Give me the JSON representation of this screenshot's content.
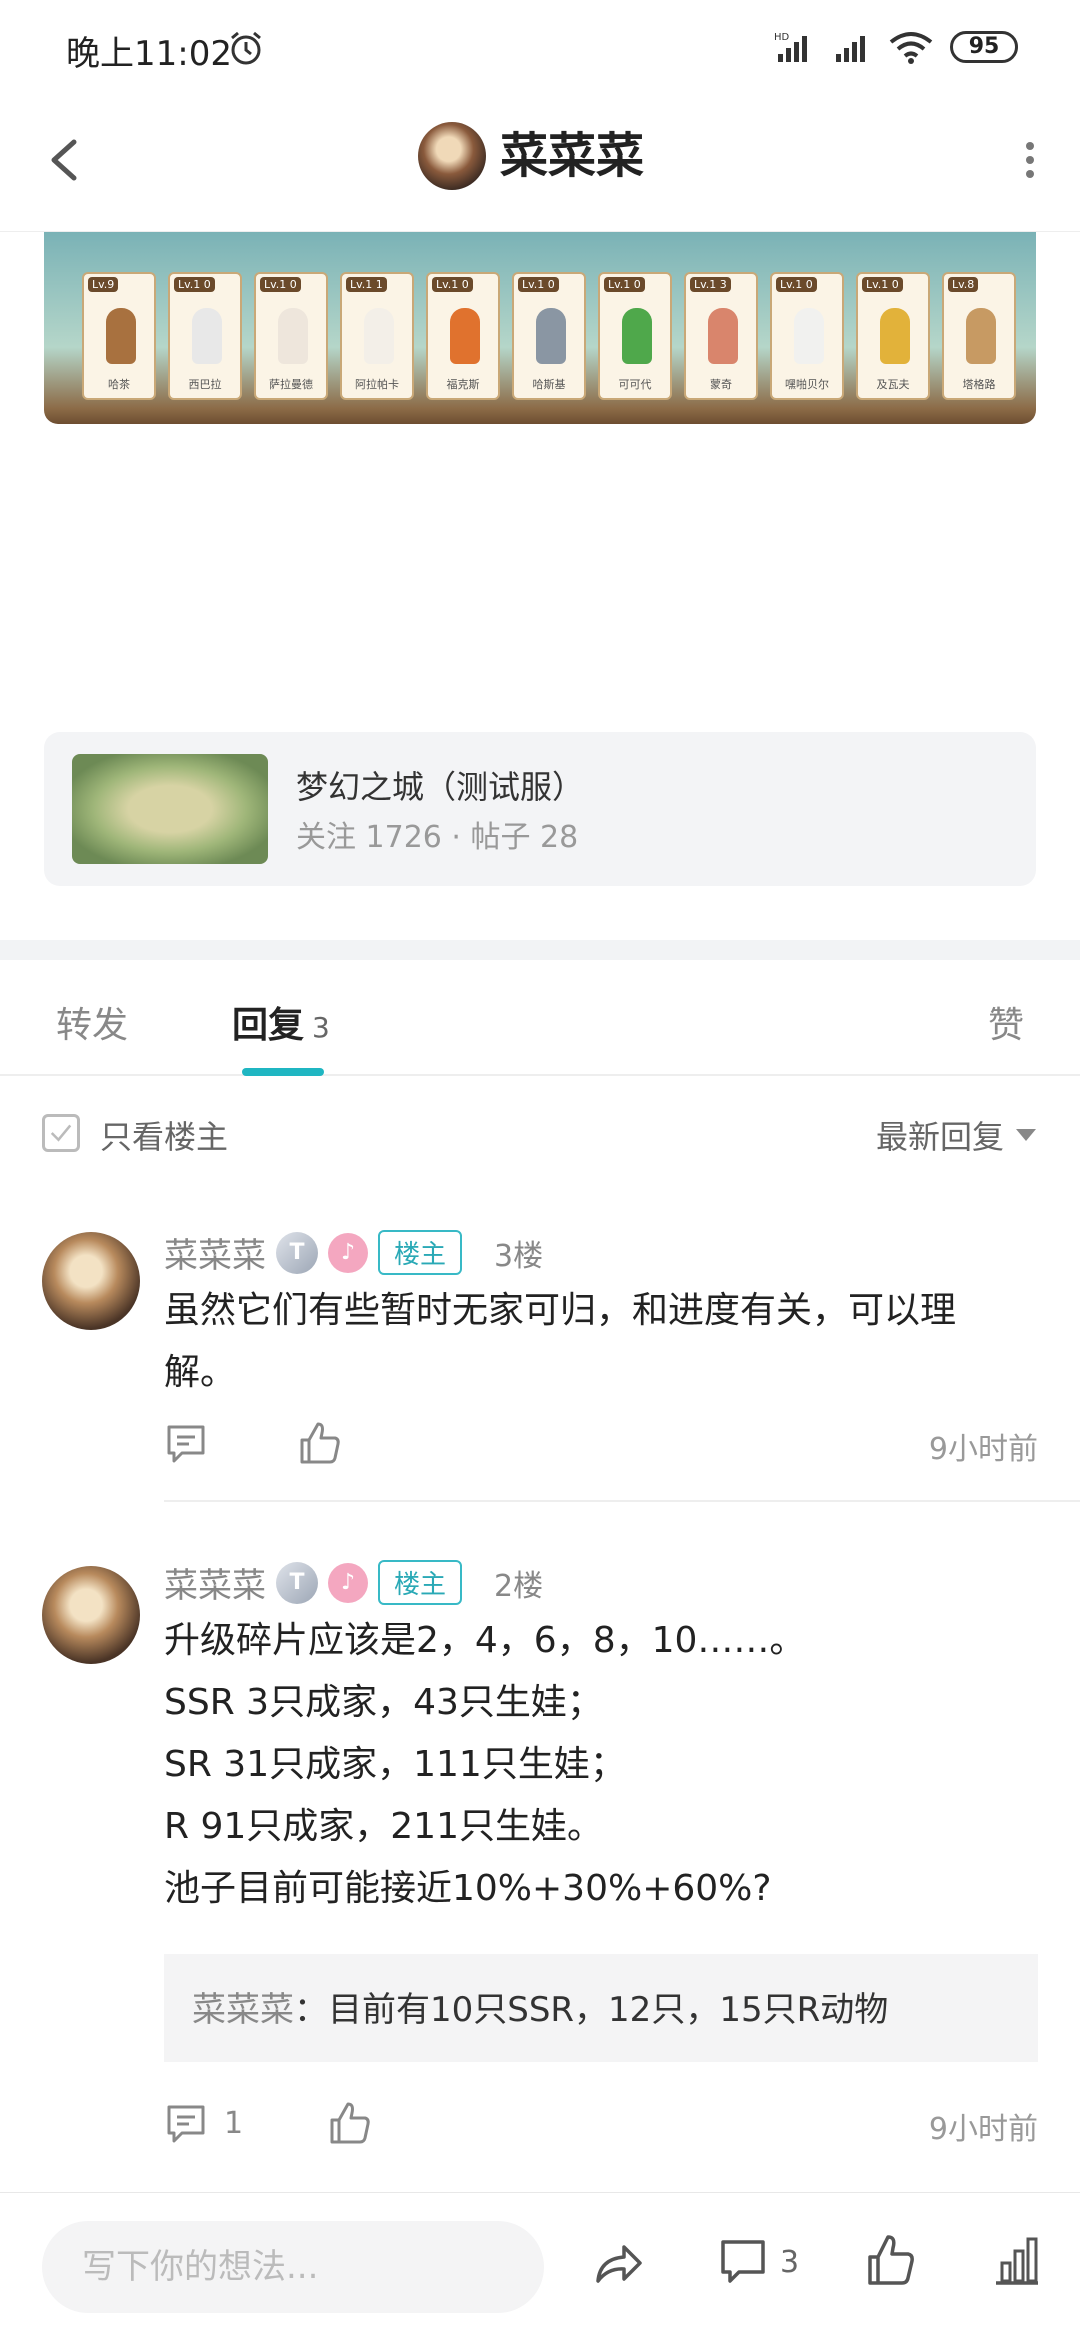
{
  "status_bar": {
    "time": "晚上11:02",
    "battery": "95"
  },
  "header": {
    "title": "菜菜菜"
  },
  "game_cards": [
    {
      "lv": "Lv.9",
      "name": "哈茶",
      "color": "#a8713f"
    },
    {
      "lv": "Lv.1 0",
      "name": "西巴拉",
      "color": "#e8e8e8"
    },
    {
      "lv": "Lv.1 0",
      "name": "萨拉曼德",
      "color": "#eee6dc"
    },
    {
      "lv": "Lv.1 1",
      "name": "阿拉帕卡",
      "color": "#f3efe8"
    },
    {
      "lv": "Lv.1 0",
      "name": "福克斯",
      "color": "#e0722e"
    },
    {
      "lv": "Lv.1 0",
      "name": "哈斯基",
      "color": "#8a96a3"
    },
    {
      "lv": "Lv.1 0",
      "name": "可可代",
      "color": "#4fa84b"
    },
    {
      "lv": "Lv.1 3",
      "name": "蒙奇",
      "color": "#d9856c"
    },
    {
      "lv": "Lv.1 0",
      "name": "嘿啪贝尔",
      "color": "#f1f1ef"
    },
    {
      "lv": "Lv.1 0",
      "name": "及瓦夫",
      "color": "#e2b23a"
    },
    {
      "lv": "Lv.8",
      "name": "塔格路",
      "color": "#c79a63"
    }
  ],
  "forum": {
    "name": "梦幻之城（测试服）",
    "stats": "关注 1726 · 帖子 28"
  },
  "tabs": {
    "repost": "转发",
    "reply": "回复",
    "reply_count": "3",
    "like": "赞"
  },
  "filter": {
    "only_owner": "只看楼主",
    "sort": "最新回复"
  },
  "replies": [
    {
      "name": "菜菜菜",
      "badge_t": "T",
      "owner_tag": "楼主",
      "floor": "3楼",
      "lines": [
        "虽然它们有些暂时无家可归，和进度有关，可以理",
        "解。"
      ],
      "comment_count": "",
      "time": "9小时前"
    },
    {
      "name": "菜菜菜",
      "badge_t": "T",
      "owner_tag": "楼主",
      "floor": "2楼",
      "lines": [
        "升级碎片应该是2，4，6，8，10……。",
        "SSR  3只成家，43只生娃；",
        "SR  31只成家，111只生娃；",
        "R    91只成家，211只生娃。",
        "池子目前可能接近10%+30%+60%?"
      ],
      "quote": {
        "name": "菜菜菜",
        "text": "：目前有10只SSR，12只，15只R动物"
      },
      "comment_count": "1",
      "time": "9小时前"
    }
  ],
  "bottom_bar": {
    "placeholder": "写下你的想法...",
    "comment_count": "3"
  },
  "colors": {
    "accent": "#1fb6c2",
    "owner_tag": "#38b9c6"
  }
}
